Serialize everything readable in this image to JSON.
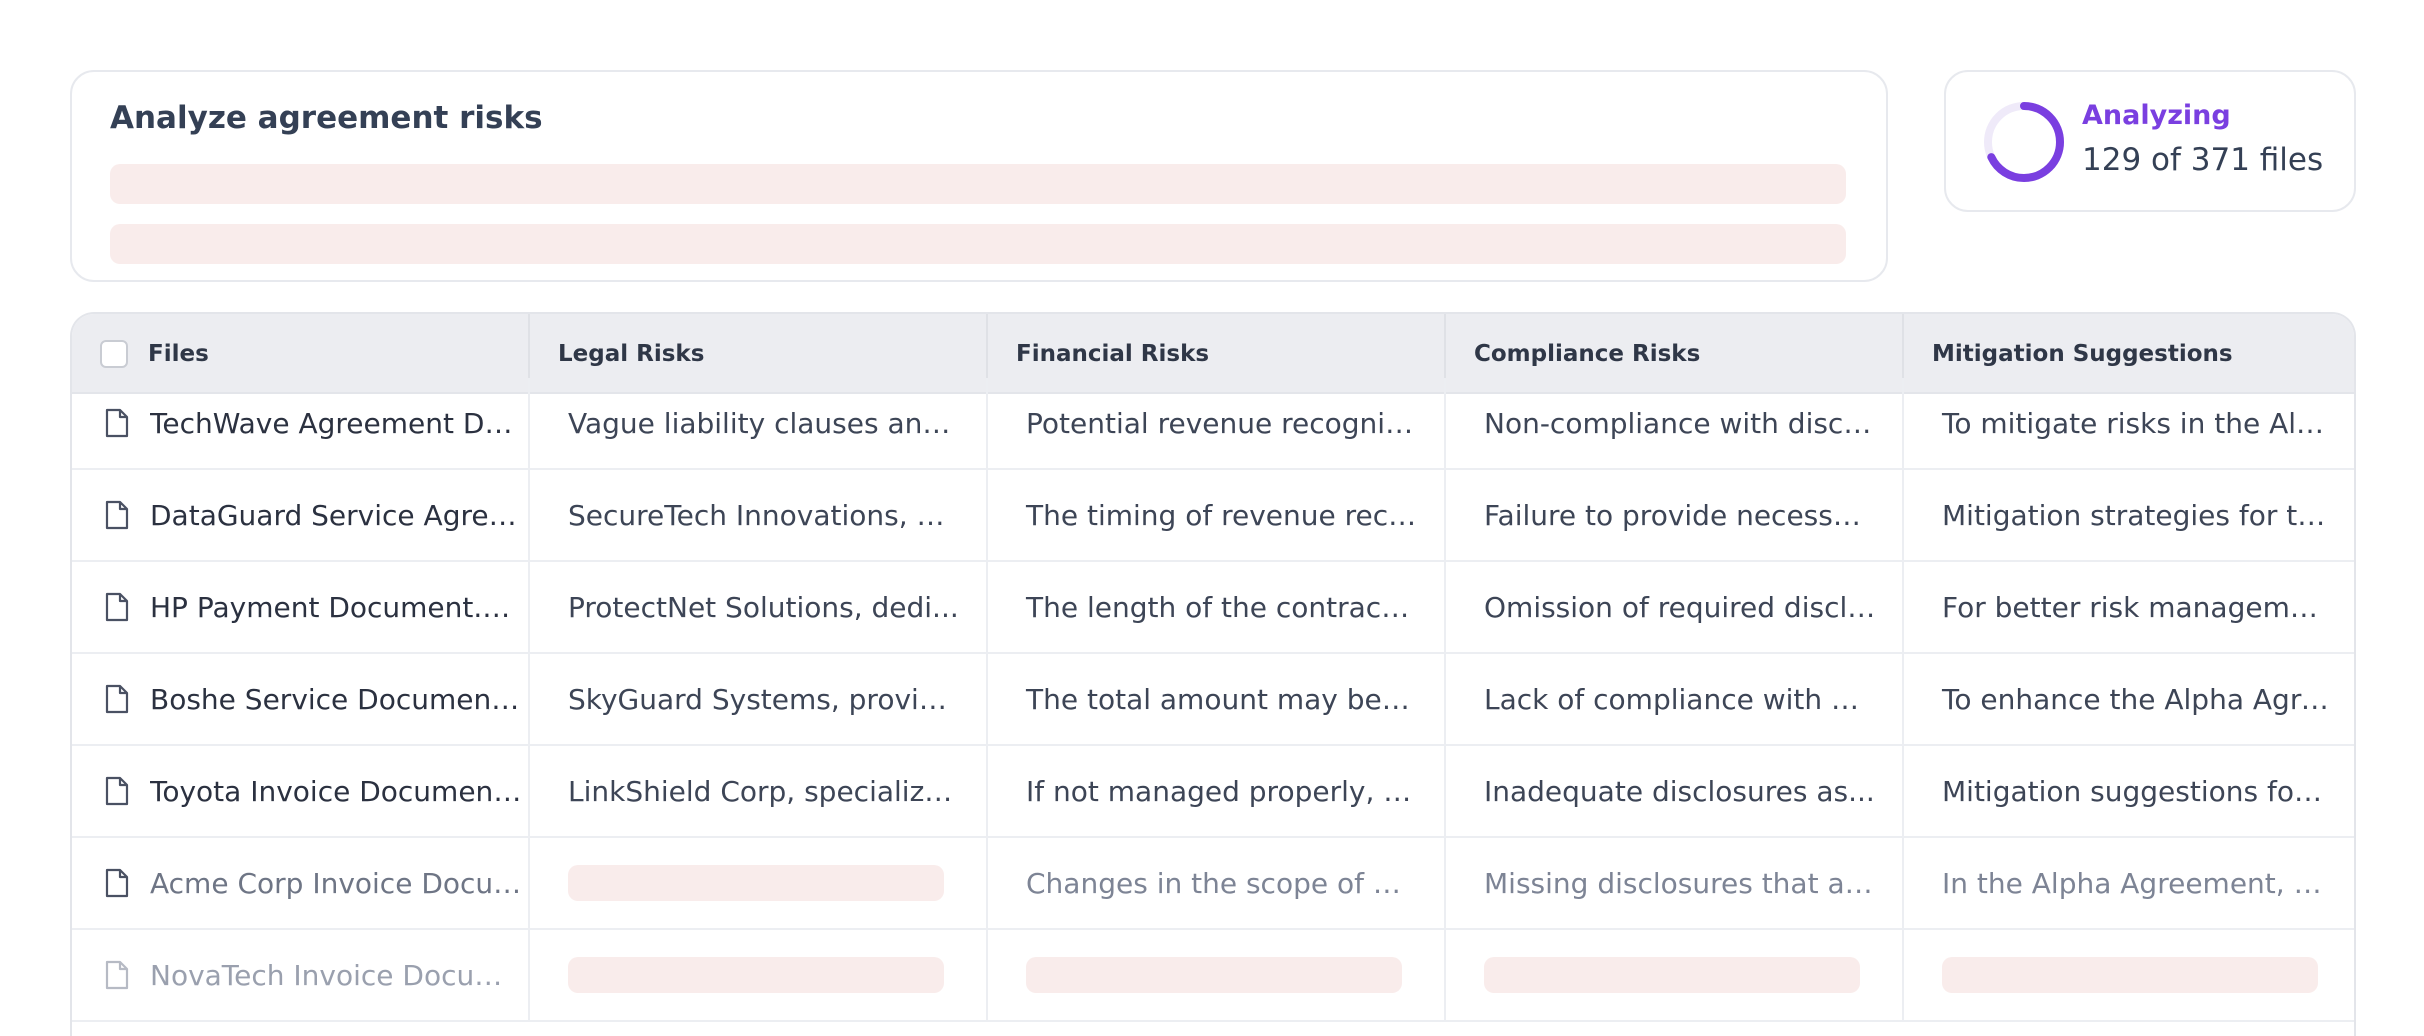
{
  "task": {
    "title": "Analyze agreement risks"
  },
  "status": {
    "label": "Analyzing",
    "count_text": "129 of 371 files",
    "processed": 129,
    "total": 371,
    "accent_color": "#7a3fe0"
  },
  "table": {
    "columns": [
      "Files",
      "Legal Risks",
      "Financial Risks",
      "Compliance Risks",
      "Mitigation Suggestions"
    ],
    "rows": [
      {
        "file": "TechWave Agreement Document.doc",
        "legal": "Vague liability clauses and...",
        "financial": "Potential revenue recogniti...",
        "compliance": "Non-compliance with discl...",
        "mitigation": "To mitigate risks in the Alph..."
      },
      {
        "file": "DataGuard Service Agreement.doc",
        "legal": "SecureTech Innovations, a l...",
        "financial": "The timing of revenue reco...",
        "compliance": "Failure to provide necessar...",
        "mitigation": "Mitigation strategies for th..."
      },
      {
        "file": "HP Payment Document.doc",
        "legal": "ProtectNet Solutions, dedi...",
        "financial": "The length of the contract...",
        "compliance": "Omission of required disclo...",
        "mitigation": "For better risk managemen..."
      },
      {
        "file": "Boshe Service Document.doc",
        "legal": "SkyGuard Systems, providi...",
        "financial": "The total amount may be a...",
        "compliance": "Lack of compliance with A...",
        "mitigation": "To enhance the Alpha Agre..."
      },
      {
        "file": "Toyota Invoice Document.doc",
        "legal": "LinkShield Corp, specializin...",
        "financial": "If not managed properly, p...",
        "compliance": "Inadequate disclosures as...",
        "mitigation": "Mitigation suggestions for t..."
      },
      {
        "file": "Acme Corp Invoice Document.doc",
        "legal": null,
        "financial": "Changes in the scope of w...",
        "compliance": "Missing disclosures that ar...",
        "mitigation": "In the Alpha Agreement, co..."
      },
      {
        "file": "NovaTech Invoice Document.doc",
        "legal": null,
        "financial": null,
        "compliance": null,
        "mitigation": null
      }
    ]
  }
}
